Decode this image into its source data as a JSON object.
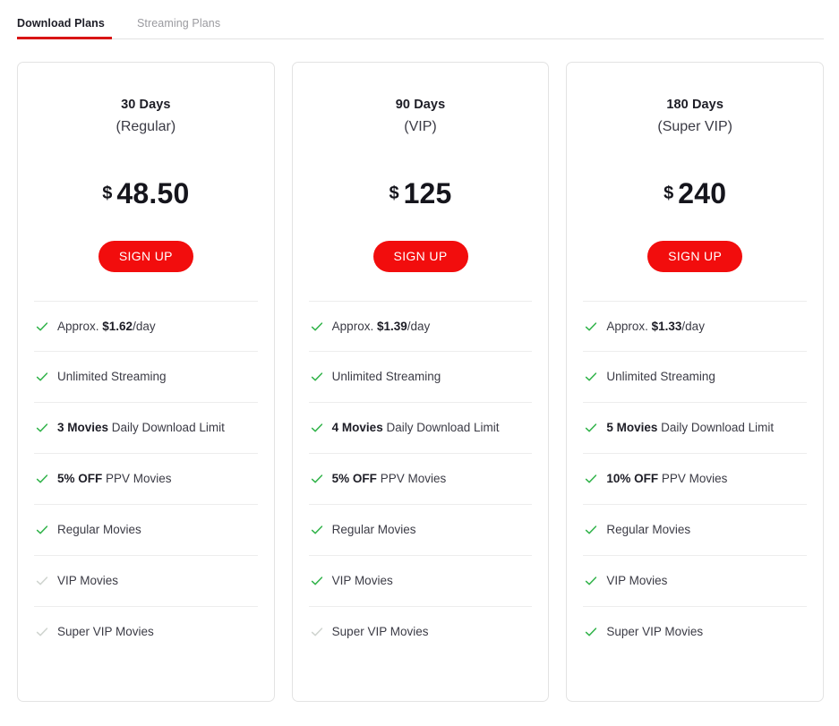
{
  "tabs": [
    {
      "label": "Download Plans",
      "active": true
    },
    {
      "label": "Streaming Plans",
      "active": false
    }
  ],
  "accent_color": "#d81515",
  "button_color": "#f20d0d",
  "check_on_color": "#31b34a",
  "check_off_color": "#cfd4cf",
  "signup_label": "SIGN UP",
  "currency": "$",
  "plans": [
    {
      "duration": "30 Days",
      "tier": "(Regular)",
      "price": "48.50",
      "features": [
        {
          "pre": "Approx. ",
          "bold": "$1.62",
          "post": "/day",
          "enabled": true
        },
        {
          "pre": "",
          "bold": "",
          "post": "Unlimited Streaming",
          "enabled": true
        },
        {
          "pre": "",
          "bold": "3 Movies",
          "post": " Daily Download Limit",
          "enabled": true
        },
        {
          "pre": "",
          "bold": "5% OFF",
          "post": " PPV Movies",
          "enabled": true
        },
        {
          "pre": "",
          "bold": "",
          "post": "Regular Movies",
          "enabled": true
        },
        {
          "pre": "",
          "bold": "",
          "post": "VIP Movies",
          "enabled": false
        },
        {
          "pre": "",
          "bold": "",
          "post": "Super VIP Movies",
          "enabled": false
        }
      ]
    },
    {
      "duration": "90 Days",
      "tier": "(VIP)",
      "price": "125",
      "features": [
        {
          "pre": "Approx. ",
          "bold": "$1.39",
          "post": "/day",
          "enabled": true
        },
        {
          "pre": "",
          "bold": "",
          "post": "Unlimited Streaming",
          "enabled": true
        },
        {
          "pre": "",
          "bold": "4 Movies",
          "post": " Daily Download Limit",
          "enabled": true
        },
        {
          "pre": "",
          "bold": "5% OFF",
          "post": " PPV Movies",
          "enabled": true
        },
        {
          "pre": "",
          "bold": "",
          "post": "Regular Movies",
          "enabled": true
        },
        {
          "pre": "",
          "bold": "",
          "post": "VIP Movies",
          "enabled": true
        },
        {
          "pre": "",
          "bold": "",
          "post": "Super VIP Movies",
          "enabled": false
        }
      ]
    },
    {
      "duration": "180 Days",
      "tier": "(Super VIP)",
      "price": "240",
      "features": [
        {
          "pre": "Approx. ",
          "bold": "$1.33",
          "post": "/day",
          "enabled": true
        },
        {
          "pre": "",
          "bold": "",
          "post": "Unlimited Streaming",
          "enabled": true
        },
        {
          "pre": "",
          "bold": "5 Movies",
          "post": " Daily Download Limit",
          "enabled": true
        },
        {
          "pre": "",
          "bold": "10% OFF",
          "post": " PPV Movies",
          "enabled": true
        },
        {
          "pre": "",
          "bold": "",
          "post": "Regular Movies",
          "enabled": true
        },
        {
          "pre": "",
          "bold": "",
          "post": "VIP Movies",
          "enabled": true
        },
        {
          "pre": "",
          "bold": "",
          "post": "Super VIP Movies",
          "enabled": true
        }
      ]
    }
  ]
}
